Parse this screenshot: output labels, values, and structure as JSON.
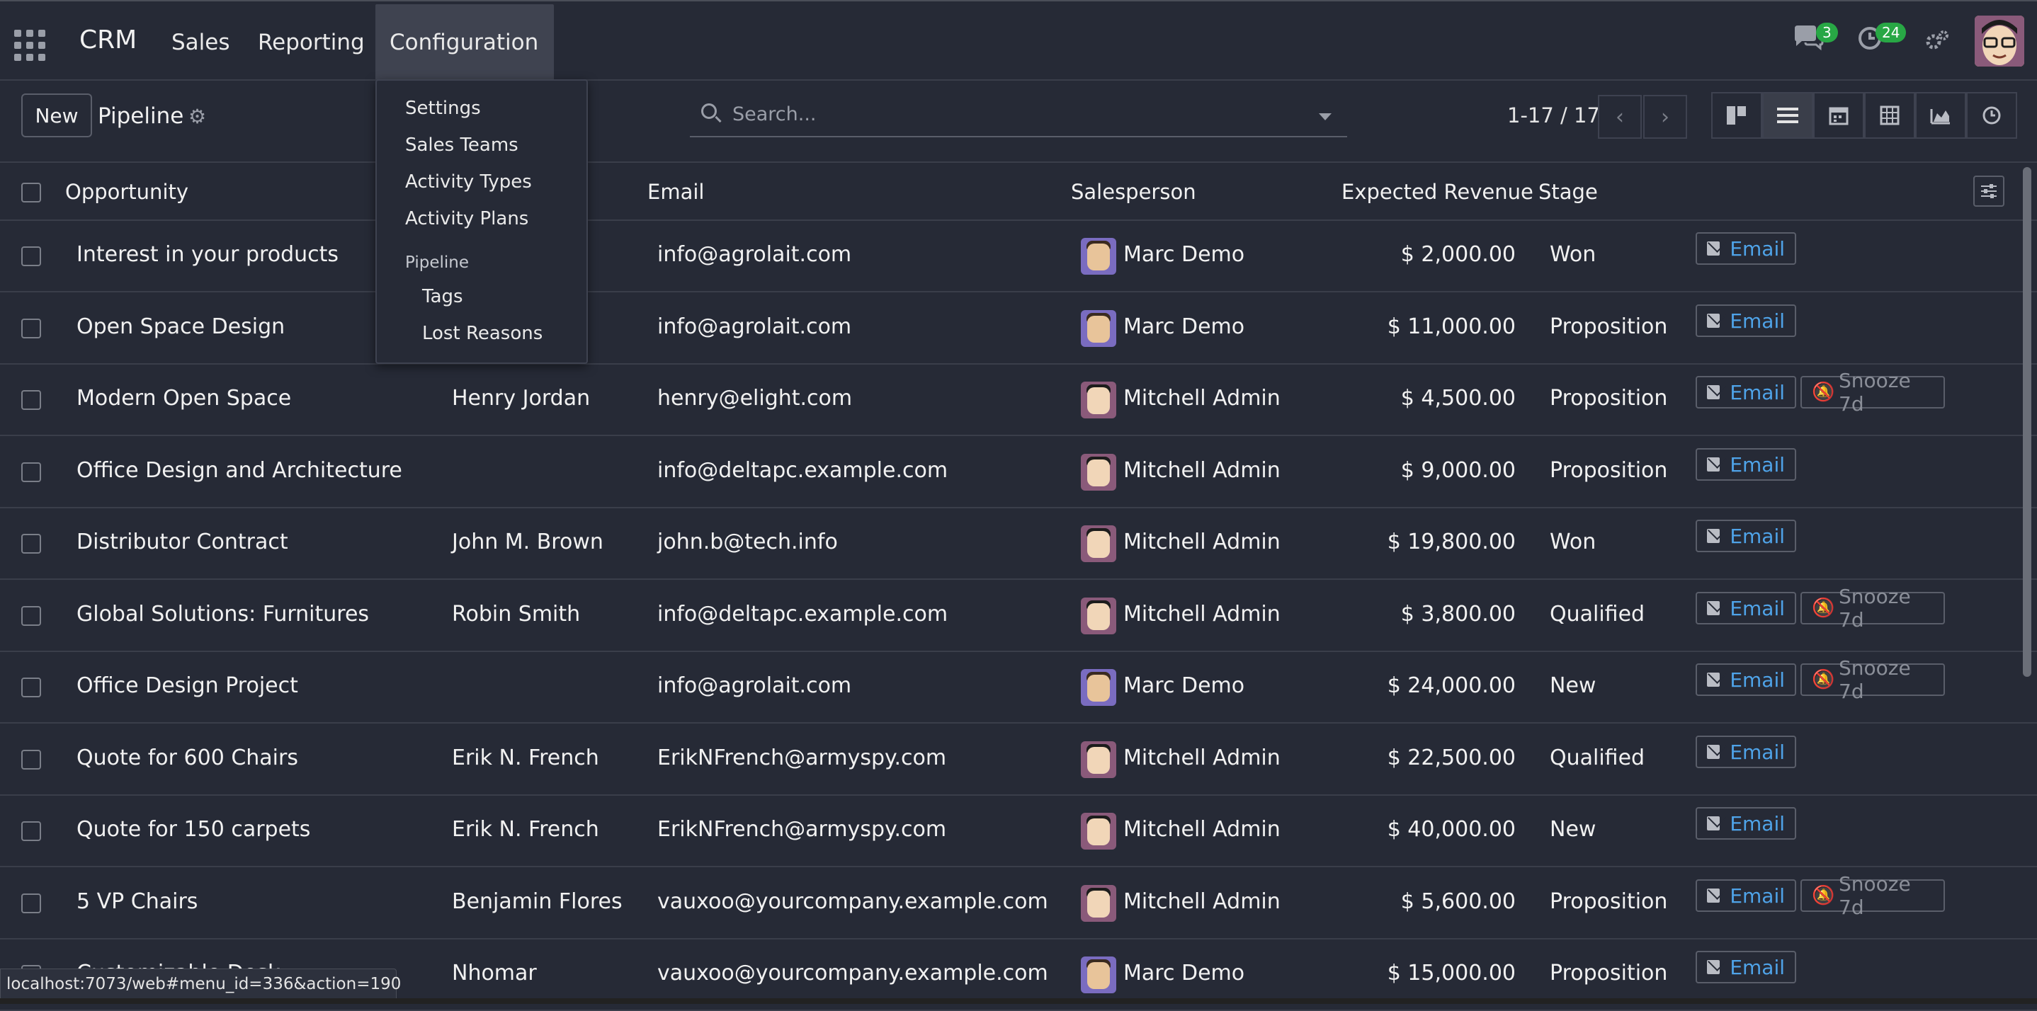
{
  "app": {
    "brand": "CRM",
    "nav": [
      "Sales",
      "Reporting",
      "Configuration"
    ],
    "messages_count": "3",
    "activities_count": "24"
  },
  "control_panel": {
    "new_label": "New",
    "title": "Pipeline",
    "search_placeholder": "Search...",
    "pager": "1-17 / 17"
  },
  "config_menu": {
    "items": [
      "Settings",
      "Sales Teams",
      "Activity Types",
      "Activity Plans"
    ],
    "section": "Pipeline",
    "sub_items": [
      "Tags",
      "Lost Reasons"
    ]
  },
  "table": {
    "headers": {
      "opportunity": "Opportunity",
      "email": "Email",
      "salesperson": "Salesperson",
      "revenue": "Expected Revenue",
      "stage": "Stage"
    },
    "rows": [
      {
        "opportunity": "Interest in your products",
        "contact": "",
        "email": "info@agrolait.com",
        "salesperson": "Marc Demo",
        "revenue": "$ 2,000.00",
        "stage": "Won",
        "snooze": false
      },
      {
        "opportunity": "Open Space Design",
        "contact": "",
        "email": "info@agrolait.com",
        "salesperson": "Marc Demo",
        "revenue": "$ 11,000.00",
        "stage": "Proposition",
        "snooze": false
      },
      {
        "opportunity": "Modern Open Space",
        "contact": "Henry Jordan",
        "email": "henry@elight.com",
        "salesperson": "Mitchell Admin",
        "revenue": "$ 4,500.00",
        "stage": "Proposition",
        "snooze": true
      },
      {
        "opportunity": "Office Design and Architecture",
        "contact": "",
        "email": "info@deltapc.example.com",
        "salesperson": "Mitchell Admin",
        "revenue": "$ 9,000.00",
        "stage": "Proposition",
        "snooze": false
      },
      {
        "opportunity": "Distributor Contract",
        "contact": "John M. Brown",
        "email": "john.b@tech.info",
        "salesperson": "Mitchell Admin",
        "revenue": "$ 19,800.00",
        "stage": "Won",
        "snooze": false
      },
      {
        "opportunity": "Global Solutions: Furnitures",
        "contact": "Robin Smith",
        "email": "info@deltapc.example.com",
        "salesperson": "Mitchell Admin",
        "revenue": "$ 3,800.00",
        "stage": "Qualified",
        "snooze": true
      },
      {
        "opportunity": "Office Design Project",
        "contact": "",
        "email": "info@agrolait.com",
        "salesperson": "Marc Demo",
        "revenue": "$ 24,000.00",
        "stage": "New",
        "snooze": true
      },
      {
        "opportunity": "Quote for 600 Chairs",
        "contact": "Erik N. French",
        "email": "ErikNFrench@armyspy.com",
        "salesperson": "Mitchell Admin",
        "revenue": "$ 22,500.00",
        "stage": "Qualified",
        "snooze": false
      },
      {
        "opportunity": "Quote for 150 carpets",
        "contact": "Erik N. French",
        "email": "ErikNFrench@armyspy.com",
        "salesperson": "Mitchell Admin",
        "revenue": "$ 40,000.00",
        "stage": "New",
        "snooze": false
      },
      {
        "opportunity": "5 VP Chairs",
        "contact": "Benjamin Flores",
        "email": "vauxoo@yourcompany.example.com",
        "salesperson": "Mitchell Admin",
        "revenue": "$ 5,600.00",
        "stage": "Proposition",
        "snooze": true
      },
      {
        "opportunity": "Customizable Desk",
        "contact": "Nhomar",
        "email": "vauxoo@yourcompany.example.com",
        "salesperson": "Marc Demo",
        "revenue": "$ 15,000.00",
        "stage": "Proposition",
        "snooze": false
      }
    ],
    "email_action": "Email",
    "snooze_action": "Snooze 7d"
  },
  "status_url": "localhost:7073/web#menu_id=336&action=190"
}
